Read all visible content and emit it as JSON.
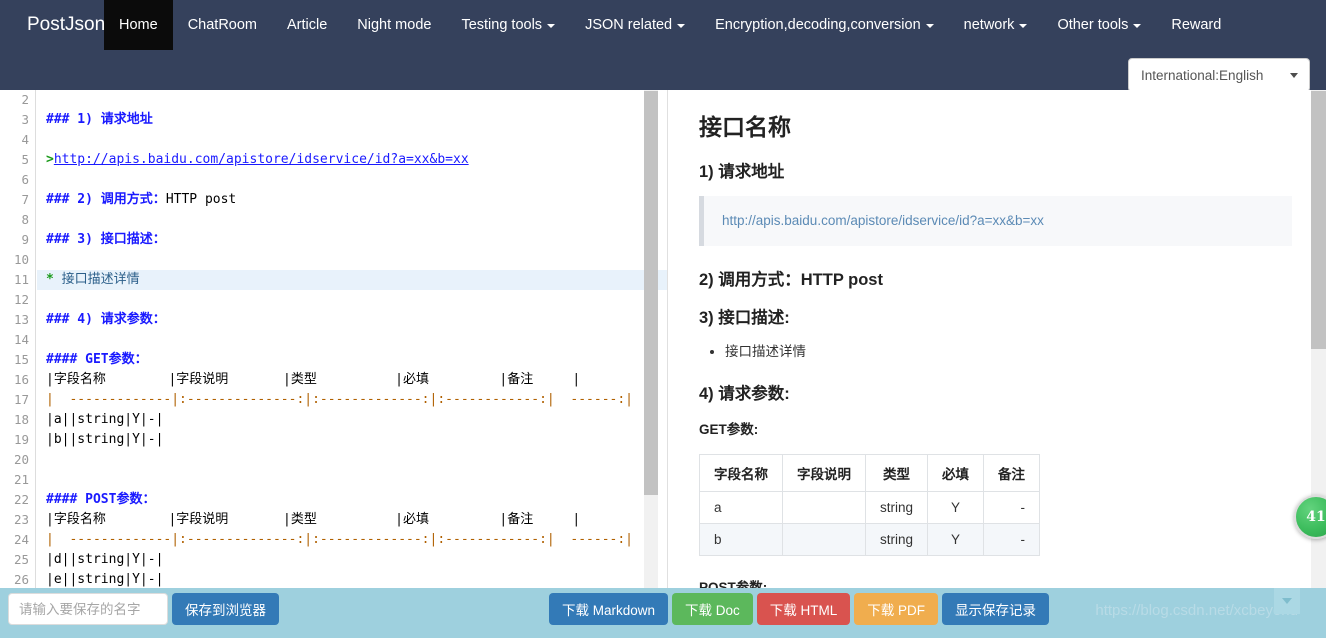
{
  "navbar": {
    "brand": "PostJson",
    "items": [
      {
        "label": "Home",
        "active": true,
        "caret": false
      },
      {
        "label": "ChatRoom",
        "active": false,
        "caret": false
      },
      {
        "label": "Article",
        "active": false,
        "caret": false
      },
      {
        "label": "Night mode",
        "active": false,
        "caret": false
      },
      {
        "label": "Testing tools",
        "active": false,
        "caret": true
      },
      {
        "label": "JSON related",
        "active": false,
        "caret": true
      },
      {
        "label": "Encryption,decoding,conversion",
        "active": false,
        "caret": true
      },
      {
        "label": "network",
        "active": false,
        "caret": true
      },
      {
        "label": "Other tools",
        "active": false,
        "caret": true
      },
      {
        "label": "Reward",
        "active": false,
        "caret": false
      }
    ],
    "language_select": {
      "value": "International:English",
      "options": [
        "International:English"
      ]
    }
  },
  "editor": {
    "first_visible_line": 2,
    "lines": [
      {
        "n": 2,
        "segments": []
      },
      {
        "n": 3,
        "segments": [
          {
            "t": "### 1) ",
            "c": "tok-hd-plain"
          },
          {
            "t": "请求地址",
            "c": "tok-head"
          }
        ]
      },
      {
        "n": 4,
        "segments": []
      },
      {
        "n": 5,
        "segments": [
          {
            "t": ">",
            "c": "tok-quote-mark"
          },
          {
            "t": "http://apis.baidu.com/apistore/idservice/id?a=xx&b=xx",
            "c": "tok-link"
          }
        ]
      },
      {
        "n": 6,
        "segments": []
      },
      {
        "n": 7,
        "segments": [
          {
            "t": "### 2) ",
            "c": "tok-hd-plain"
          },
          {
            "t": "调用方式：",
            "c": "tok-head"
          },
          {
            "t": "HTTP post",
            "c": "tok-plain"
          }
        ]
      },
      {
        "n": 8,
        "segments": []
      },
      {
        "n": 9,
        "segments": [
          {
            "t": "### 3) ",
            "c": "tok-hd-plain"
          },
          {
            "t": "接口描述：",
            "c": "tok-head"
          }
        ]
      },
      {
        "n": 10,
        "segments": []
      },
      {
        "n": 11,
        "highlight": true,
        "segments": [
          {
            "t": "* ",
            "c": "tok-bullet"
          },
          {
            "t": "接口描述详情",
            "c": "tok-list-text"
          }
        ]
      },
      {
        "n": 12,
        "segments": []
      },
      {
        "n": 13,
        "segments": [
          {
            "t": "### 4) ",
            "c": "tok-hd-plain"
          },
          {
            "t": "请求参数：",
            "c": "tok-head"
          }
        ]
      },
      {
        "n": 14,
        "segments": []
      },
      {
        "n": 15,
        "segments": [
          {
            "t": "#### GET",
            "c": "tok-hd-plain"
          },
          {
            "t": "参数：",
            "c": "tok-head"
          }
        ]
      },
      {
        "n": 16,
        "segments": [
          {
            "t": "|字段名称        |字段说明       |类型          |必填         |备注     |",
            "c": "tok-table"
          }
        ]
      },
      {
        "n": 17,
        "segments": [
          {
            "t": "|  -------------|:--------------:|:-------------:|:------------:|  ------:|",
            "c": "tok-sep"
          }
        ]
      },
      {
        "n": 18,
        "segments": [
          {
            "t": "|a||string|Y|-|",
            "c": "tok-table"
          }
        ]
      },
      {
        "n": 19,
        "segments": [
          {
            "t": "|b||string|Y|-|",
            "c": "tok-table"
          }
        ]
      },
      {
        "n": 20,
        "segments": []
      },
      {
        "n": 21,
        "segments": []
      },
      {
        "n": 22,
        "segments": [
          {
            "t": "#### POST",
            "c": "tok-hd-plain"
          },
          {
            "t": "参数：",
            "c": "tok-head"
          }
        ]
      },
      {
        "n": 23,
        "segments": [
          {
            "t": "|字段名称        |字段说明       |类型          |必填         |备注     |",
            "c": "tok-table"
          }
        ]
      },
      {
        "n": 24,
        "segments": [
          {
            "t": "|  -------------|:--------------:|:-------------:|:------------:|  ------:|",
            "c": "tok-sep"
          }
        ]
      },
      {
        "n": 25,
        "segments": [
          {
            "t": "|d||string|Y|-|",
            "c": "tok-table"
          }
        ]
      },
      {
        "n": 26,
        "segments": [
          {
            "t": "|e||string|Y|-|",
            "c": "tok-table"
          }
        ]
      }
    ]
  },
  "preview": {
    "title": "接口名称",
    "section1_heading": "1) 请求地址",
    "quote_url": "http://apis.baidu.com/apistore/idservice/id?a=xx&b=xx",
    "section2_heading": "2) 调用方式：HTTP post",
    "section3_heading": "3) 接口描述:",
    "bullets": [
      "接口描述详情"
    ],
    "section4_heading": "4) 请求参数:",
    "get_label": "GET参数:",
    "post_label": "POST参数:",
    "table_headers": [
      "字段名称",
      "字段说明",
      "类型",
      "必填",
      "备注"
    ],
    "get_rows": [
      [
        "a",
        "",
        "string",
        "Y",
        "-"
      ],
      [
        "b",
        "",
        "string",
        "Y",
        "-"
      ]
    ]
  },
  "floating_badge": {
    "text": "41"
  },
  "bottom_bar": {
    "save_input_placeholder": "请输入要保存的名字",
    "save_input_value": "",
    "save_button": "保存到浏览器",
    "buttons": [
      {
        "label": "下载 Markdown",
        "style": "btn-primary",
        "color": "#337ab7"
      },
      {
        "label": "下载 Doc",
        "style": "btn-success",
        "color": "#5cb85c"
      },
      {
        "label": "下载 HTML",
        "style": "btn-danger",
        "color": "#d9534f"
      },
      {
        "label": "下载 PDF",
        "style": "btn-warning",
        "color": "#f0ad4e"
      },
      {
        "label": "显示保存记录",
        "style": "btn-primary",
        "color": "#337ab7"
      }
    ],
    "watermark": "https://blog.csdn.net/xcbeyond"
  },
  "colors": {
    "navbar_bg": "#35415c",
    "nav_active_bg": "#0b0b0b",
    "bottom_bar_bg": "#9ed0de",
    "editor_heading": "#1a1aff",
    "badge_green": "#3cbc5c"
  }
}
